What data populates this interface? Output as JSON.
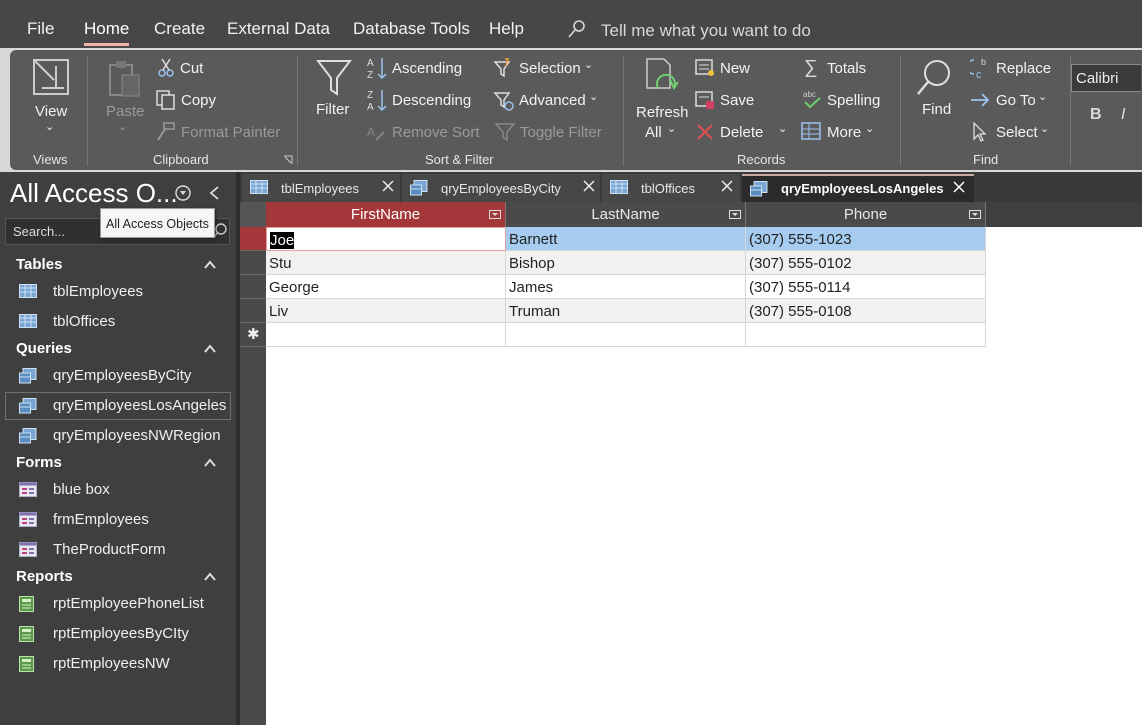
{
  "menu": {
    "file": "File",
    "home": "Home",
    "create": "Create",
    "external": "External Data",
    "dbtools": "Database Tools",
    "help": "Help",
    "tellme": "Tell me what you want to do"
  },
  "ribbon": {
    "views": {
      "view": "View",
      "group": "Views"
    },
    "clipboard": {
      "paste": "Paste",
      "cut": "Cut",
      "copy": "Copy",
      "format_painter": "Format Painter",
      "group": "Clipboard"
    },
    "sort_filter": {
      "filter": "Filter",
      "ascending": "Ascending",
      "descending": "Descending",
      "remove_sort": "Remove Sort",
      "selection": "Selection",
      "advanced": "Advanced",
      "toggle_filter": "Toggle Filter",
      "group": "Sort & Filter"
    },
    "records": {
      "refresh": "Refresh",
      "refresh_all": "All",
      "new": "New",
      "save": "Save",
      "delete": "Delete",
      "totals": "Totals",
      "spelling": "Spelling",
      "more": "More",
      "group": "Records"
    },
    "find": {
      "find": "Find",
      "replace": "Replace",
      "goto": "Go To",
      "select": "Select",
      "group": "Find"
    },
    "font": {
      "name": "Calibri",
      "bold": "B",
      "italic": "I"
    }
  },
  "nav": {
    "title": "All Access O...",
    "search_placeholder": "Search...",
    "tooltip": "All Access Objects",
    "tables": {
      "label": "Tables",
      "items": [
        "tblEmployees",
        "tblOffices"
      ]
    },
    "queries": {
      "label": "Queries",
      "items": [
        "qryEmployeesByCity",
        "qryEmployeesLosAngeles",
        "qryEmployeesNWRegion"
      ]
    },
    "forms": {
      "label": "Forms",
      "items": [
        "blue box",
        "frmEmployees",
        "TheProductForm"
      ]
    },
    "reports": {
      "label": "Reports",
      "items": [
        "rptEmployeePhoneList",
        "rptEmployeesByCIty",
        "rptEmployeesNW"
      ]
    }
  },
  "tabs": [
    "tblEmployees",
    "qryEmployeesByCity",
    "tblOffices",
    "qryEmployeesLosAngeles"
  ],
  "datasheet": {
    "columns": [
      "FirstName",
      "LastName",
      "Phone"
    ],
    "rows": [
      [
        "Joe",
        "Barnett",
        "(307) 555-1023"
      ],
      [
        "Stu",
        "Bishop",
        "(307) 555-0102"
      ],
      [
        "George",
        "James",
        "(307) 555-0114"
      ],
      [
        "Liv",
        "Truman",
        "(307) 555-0108"
      ]
    ],
    "new_record_symbol": "✱"
  },
  "colors": {
    "accent": "#a4373a",
    "selection": "#a6cdf0",
    "chrome": "#474747"
  }
}
